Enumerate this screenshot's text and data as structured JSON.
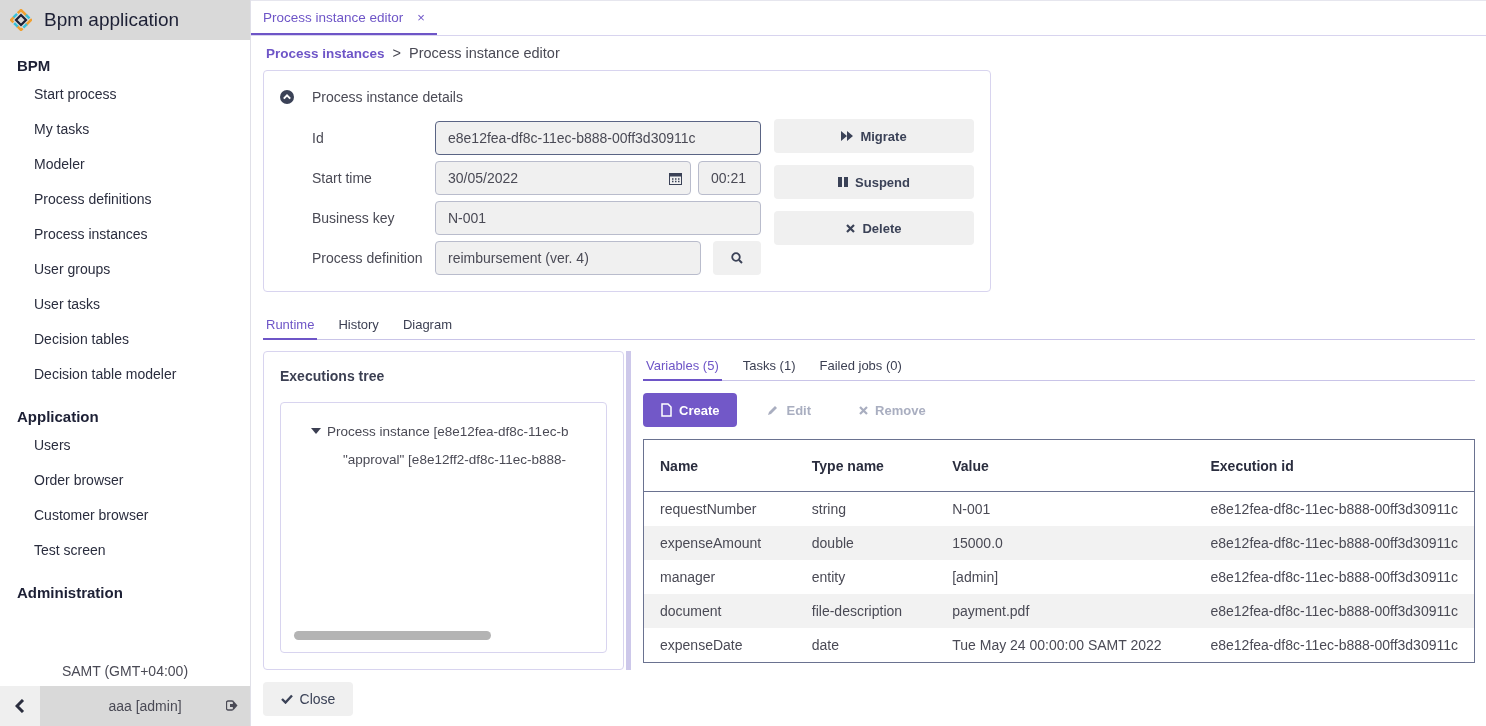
{
  "app": {
    "title": "Bpm application"
  },
  "sidebar": {
    "sections": [
      {
        "title": "BPM",
        "items": [
          {
            "label": "Start process",
            "selected": false
          },
          {
            "label": "My tasks",
            "selected": false
          },
          {
            "label": "Modeler",
            "selected": false
          },
          {
            "label": "Process definitions",
            "selected": false
          },
          {
            "label": "Process instances",
            "selected": false
          },
          {
            "label": "User groups",
            "selected": false
          },
          {
            "label": "User tasks",
            "selected": false
          },
          {
            "label": "Decision tables",
            "selected": false
          },
          {
            "label": "Decision table modeler",
            "selected": false
          }
        ]
      },
      {
        "title": "Application",
        "items": [
          {
            "label": "Users",
            "selected": false
          },
          {
            "label": "Order browser",
            "selected": false
          },
          {
            "label": "Customer browser",
            "selected": false
          },
          {
            "label": "Test screen",
            "selected": false
          }
        ]
      },
      {
        "title": "Administration"
      }
    ],
    "timezone": "SAMT (GMT+04:00)",
    "user": "aaa [admin]"
  },
  "tabs": [
    {
      "label": "Process instance editor",
      "close": "×",
      "selected": true
    }
  ],
  "breadcrumb": {
    "link": "Process instances",
    "separator": ">",
    "current": "Process instance editor"
  },
  "details": {
    "title": "Process instance details",
    "expanded": true,
    "fields": [
      {
        "label": "Id",
        "kind": "text",
        "value": "e8e12fea-df8c-11ec-b888-00ff3d30911c",
        "focused": true
      },
      {
        "label": "Start time",
        "kind": "datetime",
        "value": "30/05/2022",
        "time": "00:21",
        "focused": false
      },
      {
        "label": "Business key",
        "kind": "text",
        "value": "N-001",
        "focused": false
      },
      {
        "label": "Process definition",
        "kind": "lookup",
        "value": "reimbursement (ver. 4)",
        "focused": false
      }
    ],
    "actions": [
      {
        "label": "Migrate"
      },
      {
        "label": "Suspend"
      },
      {
        "label": "Delete"
      }
    ]
  },
  "section_tabs": [
    {
      "label": "Runtime",
      "selected": true
    },
    {
      "label": "History",
      "selected": false
    },
    {
      "label": "Diagram",
      "selected": false
    }
  ],
  "executions_tree": {
    "title": "Executions tree",
    "nodes": [
      {
        "label": "Process instance [e8e12fea-df8c-11ec-b",
        "expanded": true,
        "children": [
          {
            "label": "\"approval\" [e8e12ff2-df8c-11ec-b888-"
          }
        ]
      }
    ]
  },
  "variables": {
    "tabs": [
      {
        "label": "Variables (5)",
        "selected": true
      },
      {
        "label": "Tasks (1)",
        "selected": false
      },
      {
        "label": "Failed jobs (0)",
        "selected": false
      }
    ],
    "toolbar": [
      {
        "label": "Create",
        "kind": "primary",
        "disabled": false
      },
      {
        "label": "Edit",
        "kind": "plain",
        "disabled": true
      },
      {
        "label": "Remove",
        "kind": "plain",
        "disabled": true
      }
    ],
    "table": {
      "columns": [
        "Name",
        "Type name",
        "Value",
        "Execution id"
      ],
      "rows": [
        [
          "requestNumber",
          "string",
          "N-001",
          "e8e12fea-df8c-11ec-b888-00ff3d30911c"
        ],
        [
          "expenseAmount",
          "double",
          "15000.0",
          "e8e12fea-df8c-11ec-b888-00ff3d30911c"
        ],
        [
          "manager",
          "entity",
          "[admin]",
          "e8e12fea-df8c-11ec-b888-00ff3d30911c"
        ],
        [
          "document",
          "file-description",
          "payment.pdf",
          "e8e12fea-df8c-11ec-b888-00ff3d30911c"
        ],
        [
          "expenseDate",
          "date",
          "Tue May 24 00:00:00 SAMT 2022",
          "e8e12fea-df8c-11ec-b888-00ff3d30911c"
        ]
      ]
    }
  },
  "close_button": {
    "label": "Close"
  }
}
